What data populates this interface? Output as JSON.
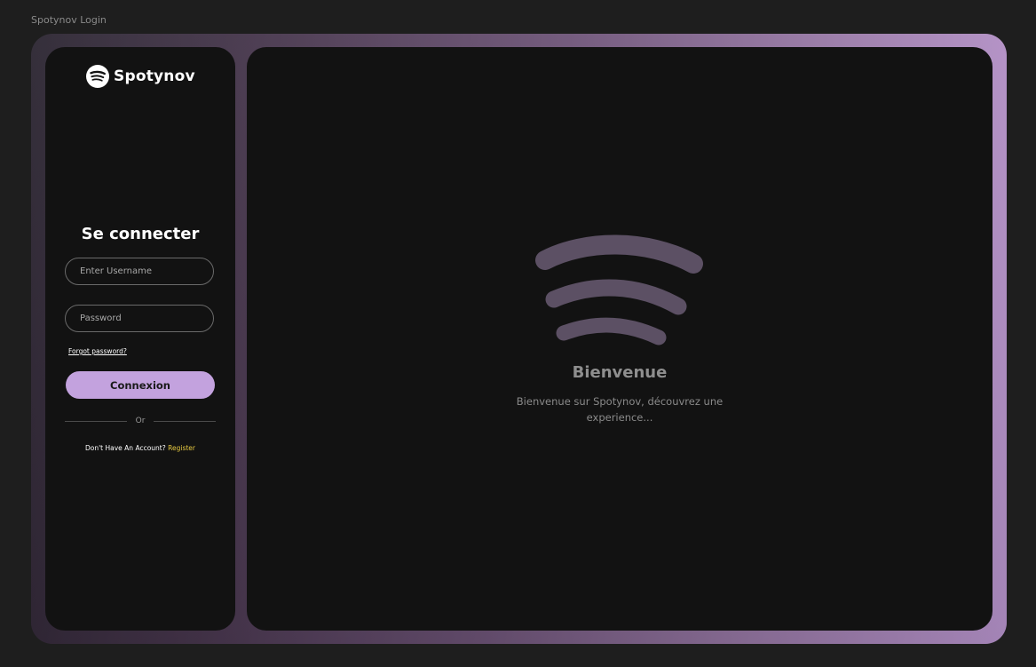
{
  "page": {
    "label": "Spotynov Login"
  },
  "brand": {
    "name": "Spotynov",
    "logo_icon": "spotify-waves-icon",
    "accent": "#c3a2de",
    "link_color": "#e5c840"
  },
  "login": {
    "title": "Se connecter",
    "username_placeholder": "Enter Username",
    "password_placeholder": "Password",
    "forgot_label": "Forgot password?",
    "submit_label": "Connexion",
    "divider_label": "Or",
    "no_account_text": "Don't Have An Account?",
    "register_label": "Register"
  },
  "welcome": {
    "icon": "sound-waves-icon",
    "title": "Bienvenue",
    "subtitle": "Bienvenue sur Spotynov, découvrez une experience..."
  }
}
